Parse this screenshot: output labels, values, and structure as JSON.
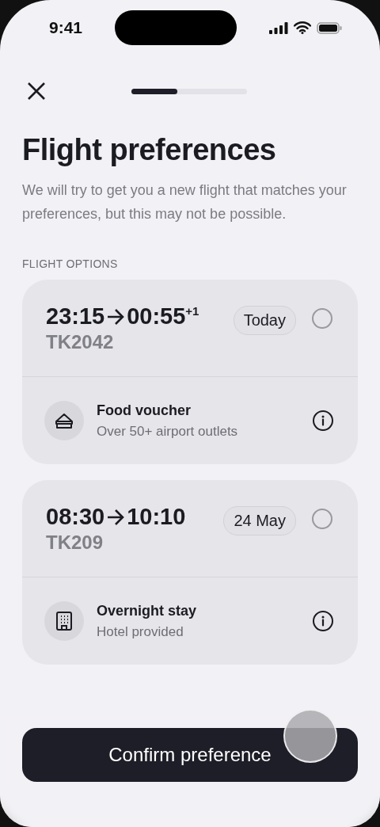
{
  "status_bar": {
    "time": "9:41"
  },
  "progress": {
    "level": 0.4
  },
  "title": "Flight preferences",
  "description": "We will try to get you a new flight that matches your preferences, but this may not be possible.",
  "section_label": "FLIGHT OPTIONS",
  "flights": [
    {
      "departure": "23:15",
      "arrival": "00:55$^{+1}$",
      "flight_number": "TK2042",
      "date": "Today",
      "selected": false,
      "perk": {
        "kind": "food",
        "title": "Food voucher",
        "subtitle": "Over 50+ airport outlets"
      }
    },
    {
      "departure": "08:30",
      "arrival": "10:10",
      "flight_number": "TK209",
      "date": "24 May",
      "selected": false,
      "perk": {
        "kind": "hotel",
        "title": "Overnight stay",
        "subtitle": "Hotel provided"
      }
    }
  ],
  "confirm_button": "Confirm preference"
}
